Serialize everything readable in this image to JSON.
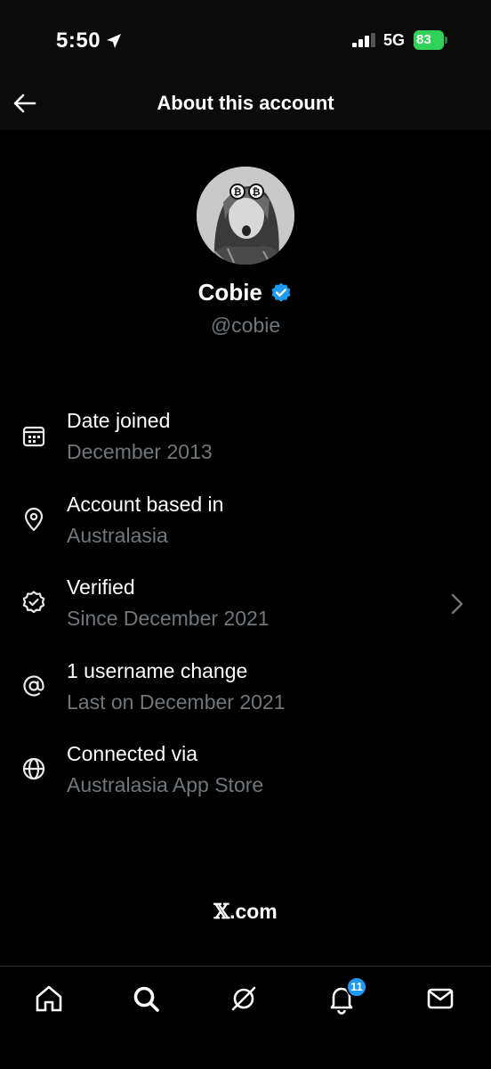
{
  "status_bar": {
    "time": "5:50",
    "network": "5G",
    "battery": "83",
    "battery_color": "#30d158",
    "icons": [
      "location-arrow-icon",
      "signal-icon",
      "battery-icon"
    ]
  },
  "header": {
    "title": "About this account",
    "back_icon": "arrow-left-icon"
  },
  "profile": {
    "display_name": "Cobie",
    "handle": "@cobie",
    "verified_icon": "verified-badge-icon",
    "verified_color": "#1d9bf0"
  },
  "info": [
    {
      "icon": "calendar-icon",
      "title": "Date joined",
      "value": "December 2013"
    },
    {
      "icon": "location-pin-icon",
      "title": "Account based in",
      "value": "Australasia"
    },
    {
      "icon": "verified-check-icon",
      "title": "Verified",
      "value": "Since December 2021",
      "chevron": "chevron-right-icon"
    },
    {
      "icon": "at-sign-icon",
      "title": "1 username change",
      "value": "Last on December 2021"
    },
    {
      "icon": "globe-icon",
      "title": "Connected via",
      "value": "Australasia App Store"
    }
  ],
  "footer": {
    "brand_letter": "𝕏",
    "brand_suffix": ".com"
  },
  "bottom_nav": {
    "items": [
      "home-icon",
      "search-icon",
      "grok-icon",
      "notifications-icon",
      "messages-icon"
    ],
    "notification_count": "11",
    "badge_color": "#1d9bf0"
  }
}
